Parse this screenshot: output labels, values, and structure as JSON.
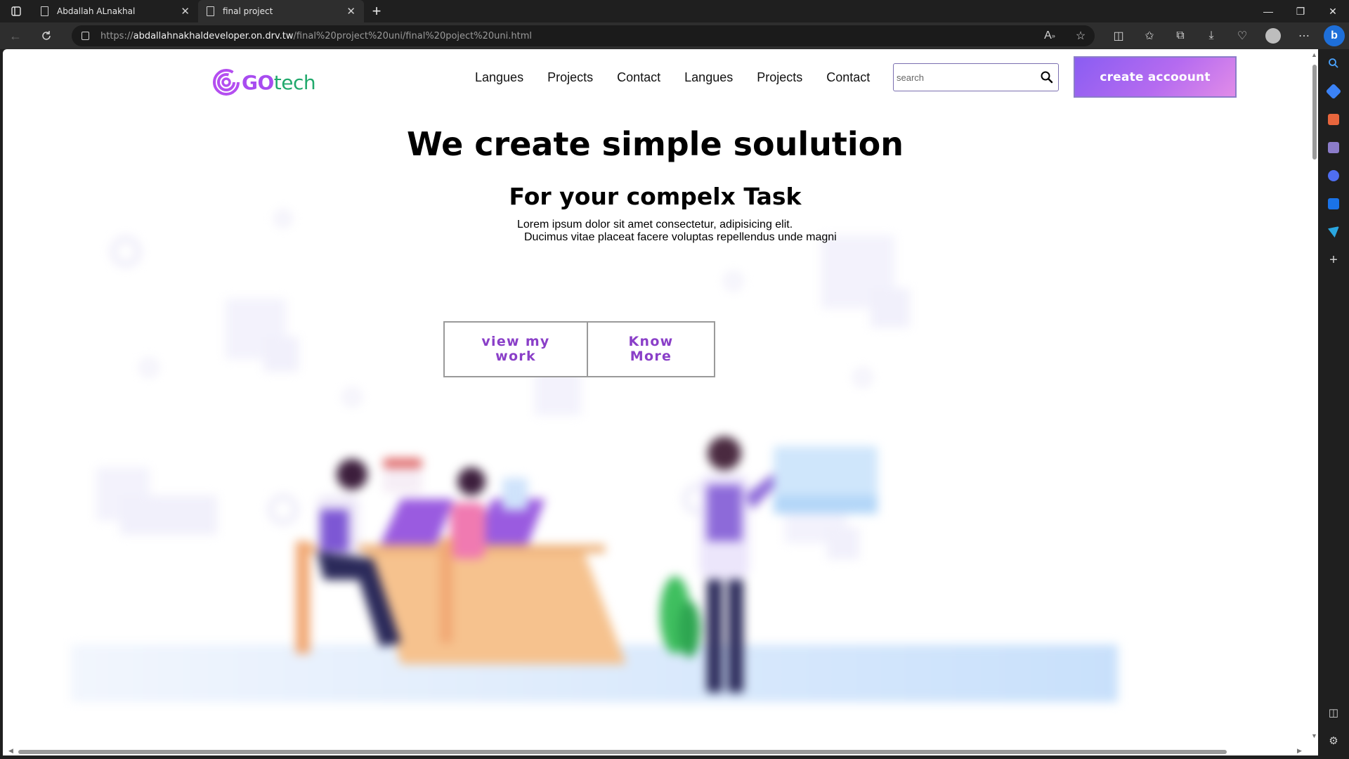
{
  "browser": {
    "tabs": [
      {
        "title": "Abdallah ALnakhal",
        "active": false
      },
      {
        "title": "final project",
        "active": true
      }
    ],
    "url": {
      "scheme": "https://",
      "host": "abdallahnakhaldeveloper.on.drv.tw",
      "path": "/final%20project%20uni/final%20poject%20uni.html"
    }
  },
  "site": {
    "logo": {
      "part1": "GO",
      "part2": "tech"
    },
    "nav": [
      "Langues",
      "Projects",
      "Contact",
      "Langues",
      "Projects",
      "Contact"
    ],
    "search_placeholder": "search",
    "create_account": "create accoount"
  },
  "hero": {
    "title": "We create simple soulution",
    "subtitle": "For your compelx Task",
    "text_line1": "Lorem ipsum dolor sit amet consectetur, adipisicing elit.",
    "text_line2": "Ducimus vitae placeat facere  voluptas repellendus unde magni",
    "button_work": "view my work",
    "button_more": "Know More"
  },
  "colors": {
    "brand_purple": "#a84cf0",
    "brand_green": "#21a96c",
    "button_gradient_start": "#8a5df2",
    "button_gradient_end": "#e18ce8"
  }
}
